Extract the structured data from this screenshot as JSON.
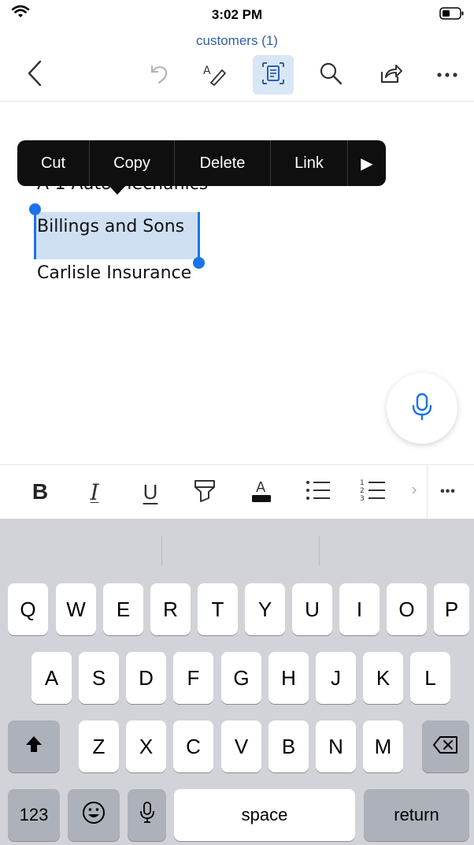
{
  "status": {
    "time": "3:02 PM"
  },
  "document": {
    "title": "customers (1)",
    "line1_partial": "A-1 Auto Mechanics",
    "line2": "Billings and Sons",
    "line3": "Carlisle Insurance"
  },
  "context_menu": {
    "items": [
      "Cut",
      "Copy",
      "Delete",
      "Link"
    ],
    "more_glyph": "▶"
  },
  "format_bar": {
    "bold": "B",
    "italic": "I",
    "underline": "U",
    "more": "•••"
  },
  "keyboard": {
    "row1": [
      "Q",
      "W",
      "E",
      "R",
      "T",
      "Y",
      "U",
      "I",
      "O",
      "P"
    ],
    "row2": [
      "A",
      "S",
      "D",
      "F",
      "G",
      "H",
      "J",
      "K",
      "L"
    ],
    "row3": [
      "Z",
      "X",
      "C",
      "V",
      "B",
      "N",
      "M"
    ],
    "numbers_label": "123",
    "space_label": "space",
    "return_label": "return"
  },
  "colors": {
    "accent": "#1a73e8",
    "title_blue": "#2f5fa8",
    "selection": "#cfe0f2",
    "keyboard_bg": "#d1d3d9"
  }
}
